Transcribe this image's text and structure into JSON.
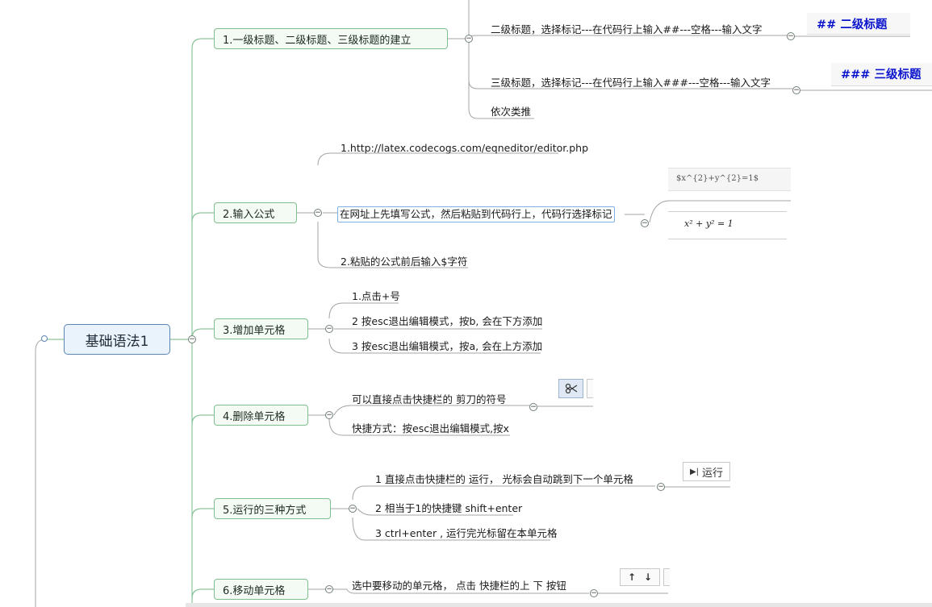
{
  "root": {
    "label": "基础语法1"
  },
  "branches": [
    {
      "label": "1.一级标题、二级标题、三级标题的建立"
    },
    {
      "label": "2.输入公式"
    },
    {
      "label": "3.增加单元格"
    },
    {
      "label": "4.删除单元格"
    },
    {
      "label": "5.运行的三种方式"
    },
    {
      "label": "6.移动单元格"
    }
  ],
  "leaves": {
    "b1": [
      "二级标题，选择标记---在代码行上输入##---空格---输入文字",
      "三级标题，选择标记---在代码行上输入###---空格---输入文字",
      "依次类推"
    ],
    "b2": [
      "1.http://latex.codecogs.com/eqneditor/editor.php",
      "在网址上先填写公式，然后粘贴到代码行上，代码行选择标记",
      "2.粘贴的公式前后输入$字符"
    ],
    "b3": [
      "1.点击+号",
      "2 按esc退出编辑模式，按b, 会在下方添加",
      "3 按esc退出编辑模式，按a, 会在上方添加"
    ],
    "b4": [
      "可以直接点击快捷栏的 剪刀的符号",
      "快捷方式：按esc退出编辑模式,按x"
    ],
    "b5": [
      "1 直接点击快捷栏的 运行， 光标会自动跳到下一个单元格",
      "2 相当于1的快捷键 shift+enter",
      "3 ctrl+enter , 运行完光标留在本单元格"
    ],
    "b6": [
      "选中要移动的单元格， 点击 快捷栏的上 下 按钮"
    ]
  },
  "images": {
    "h2_sample": "## 二级标题",
    "h3_sample": "### 三级标题",
    "latex_source": "$x^{2}+y^{2}=1$",
    "latex_rendered": "x² + y² = 1",
    "run_button": "运行",
    "scissors_icon": "scissors-icon",
    "up_icon": "arrow-up-icon",
    "down_icon": "arrow-down-icon"
  },
  "colors": {
    "root_border": "#5b86b3",
    "branch_border": "#7fbf8f",
    "heading_blue": "#0a14cc",
    "line": "#7fbf8f"
  }
}
